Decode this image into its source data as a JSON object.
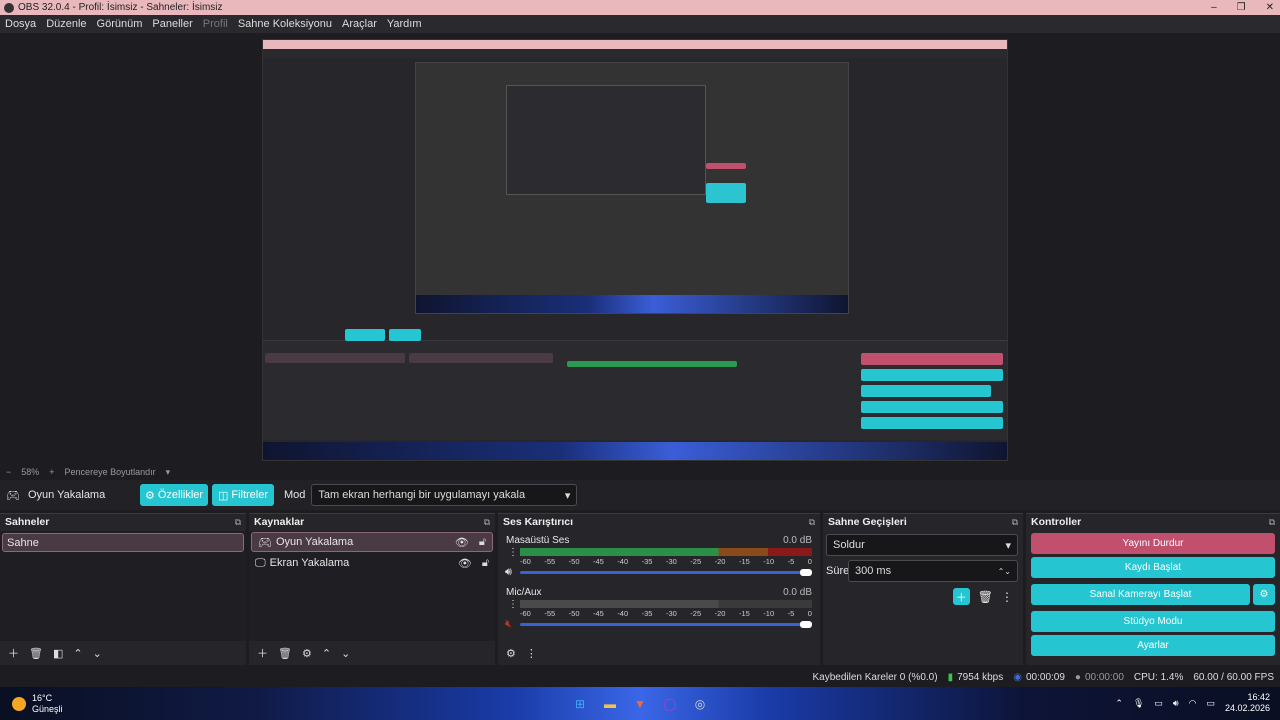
{
  "window": {
    "title": "OBS 32.0.4 - Profil: İsimsiz - Sahneler: İsimsiz",
    "controls": [
      "–",
      "❐",
      "✕"
    ]
  },
  "menu": [
    {
      "label": "Dosya",
      "disabled": false
    },
    {
      "label": "Düzenle",
      "disabled": false
    },
    {
      "label": "Görünüm",
      "disabled": false
    },
    {
      "label": "Paneller",
      "disabled": false
    },
    {
      "label": "Profil",
      "disabled": true
    },
    {
      "label": "Sahne Koleksiyonu",
      "disabled": false
    },
    {
      "label": "Araçlar",
      "disabled": false
    },
    {
      "label": "Yardım",
      "disabled": false
    }
  ],
  "zoom": {
    "minus": "−",
    "value": "58%",
    "plus": "+",
    "mode": "Pencereye Boyutlandır"
  },
  "source_bar": {
    "source_name": "Oyun Yakalama",
    "properties_label": "Özellikler",
    "filters_label": "Filtreler",
    "mode_label": "Mod",
    "mode_value": "Tam ekran herhangi bir uygulamayı yakala"
  },
  "scenes": {
    "title": "Sahneler",
    "items": [
      "Sahne"
    ]
  },
  "sources": {
    "title": "Kaynaklar",
    "items": [
      "Oyun Yakalama",
      "Ekran Yakalama"
    ]
  },
  "mixer": {
    "title": "Ses Karıştırıcı",
    "channels": [
      {
        "name": "Masaüstü Ses",
        "db": "0.0 dB",
        "volume": 0.98,
        "muted": false
      },
      {
        "name": "Mic/Aux",
        "db": "0.0 dB",
        "volume": 0.98,
        "muted": true
      }
    ],
    "scale": [
      "-60",
      "-55",
      "-50",
      "-45",
      "-40",
      "-35",
      "-30",
      "-25",
      "-20",
      "-15",
      "-10",
      "-5",
      "0"
    ]
  },
  "transitions": {
    "title": "Sahne Geçişleri",
    "transition_value": "Soldur",
    "duration_label": "Süre",
    "duration_value": "300 ms"
  },
  "controls": {
    "title": "Kontroller",
    "stop_stream": "Yayını Durdur",
    "start_recording": "Kaydı Başlat",
    "start_virtualcam": "Sanal Kamerayı Başlat",
    "studio_mode": "Stüdyo Modu",
    "settings": "Ayarlar"
  },
  "status": {
    "dropped_frames": "Kaybedilen Kareler 0 (%0.0)",
    "bitrate": "7954 kbps",
    "stream_time": "00:00:09",
    "record_time": "00:00:00",
    "cpu": "CPU: 1.4%",
    "fps": "60.00 / 60.00 FPS"
  },
  "taskbar": {
    "weather_temp": "16°C",
    "weather_desc": "Güneşli",
    "time": "16:42",
    "date": "24.02.2026"
  },
  "colors": {
    "accent": "#25c5d2",
    "stream_active": "#c0506e",
    "titlebar": "#e8b8bc"
  }
}
